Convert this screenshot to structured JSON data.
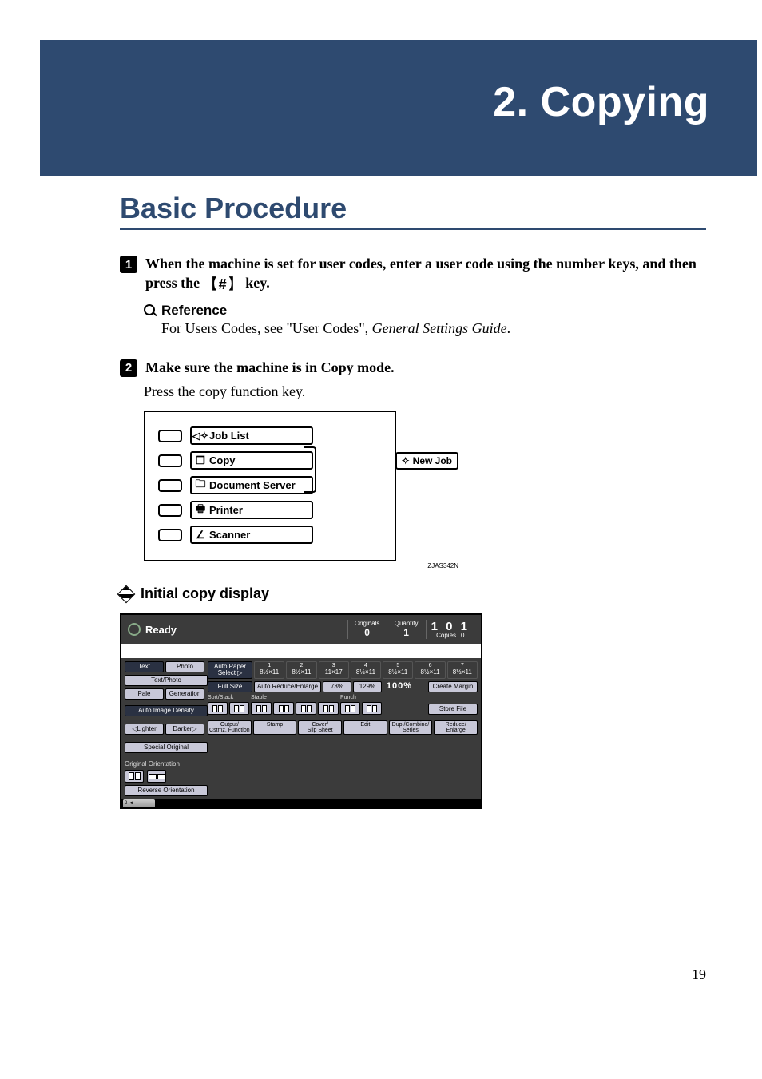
{
  "banner_title": "2. Copying",
  "section_title": "Basic Procedure",
  "steps": {
    "s1_a": "When the machine is set for user codes, enter a user code using the number keys, and then press the ",
    "s1_key": "【#】",
    "s1_b": " key."
  },
  "reference": {
    "label": "Reference",
    "body_a": "For Users Codes, see \"User Codes\", ",
    "body_em": "General Settings Guide",
    "body_b": "."
  },
  "step2": {
    "main": "Make sure the machine is in Copy mode.",
    "sub": "Press the copy function key."
  },
  "fk": {
    "job_list": "Job List",
    "copy": "Copy",
    "doc_server": "Document Server",
    "printer": "Printer",
    "scanner": "Scanner",
    "new_job": "New Job",
    "code": "ZJAS342N"
  },
  "diamond_head": "Initial copy display",
  "lcd": {
    "ready": "Ready",
    "counters": {
      "originals_label": "Originals",
      "originals_val": "0",
      "quantity_label": "Quantity",
      "quantity_val": "1",
      "copies_label": "Copies",
      "copies_val": "0",
      "copies_big": "1 0 1"
    },
    "left": {
      "text": "Text",
      "photo": "Photo",
      "text_photo": "Text/Photo",
      "pale": "Pale",
      "generation": "Generation",
      "auto_density": "Auto Image Density",
      "lighter": "◁Lighter",
      "darker": "Darker▷",
      "special_original": "Special Original",
      "orig_orientation": "Original Orientation",
      "reverse_orientation": "Reverse Orientation"
    },
    "right": {
      "auto_paper": "Auto Paper\nSelect ▷",
      "trays": [
        {
          "num": "1",
          "size": "8½×11"
        },
        {
          "num": "2",
          "size": "8½×11"
        },
        {
          "num": "3",
          "size": "11×17"
        },
        {
          "num": "4",
          "size": "8½×11"
        },
        {
          "num": "5",
          "size": "8½×11"
        },
        {
          "num": "6",
          "size": "8½×11"
        },
        {
          "num": "7",
          "size": "8½×11"
        }
      ],
      "full_size": "Full Size",
      "auto_re": "Auto Reduce/Enlarge",
      "pct73": "73%",
      "pct129": "129%",
      "pct100": "100%",
      "create_margin": "Create Margin",
      "sort_stack": "Sort/Stack",
      "staple": "Staple",
      "punch": "Punch",
      "store_file": "Store File",
      "output": "Output/\nCstmz. Function",
      "stamp": "Stamp",
      "cover": "Cover/\nSlip Sheet",
      "edit": "Edit",
      "dup": "Dup./Combine/\nSeries",
      "reduce": "Reduce/\nEnlarge"
    },
    "footer_date": "2 ◄"
  },
  "page_number": "19"
}
